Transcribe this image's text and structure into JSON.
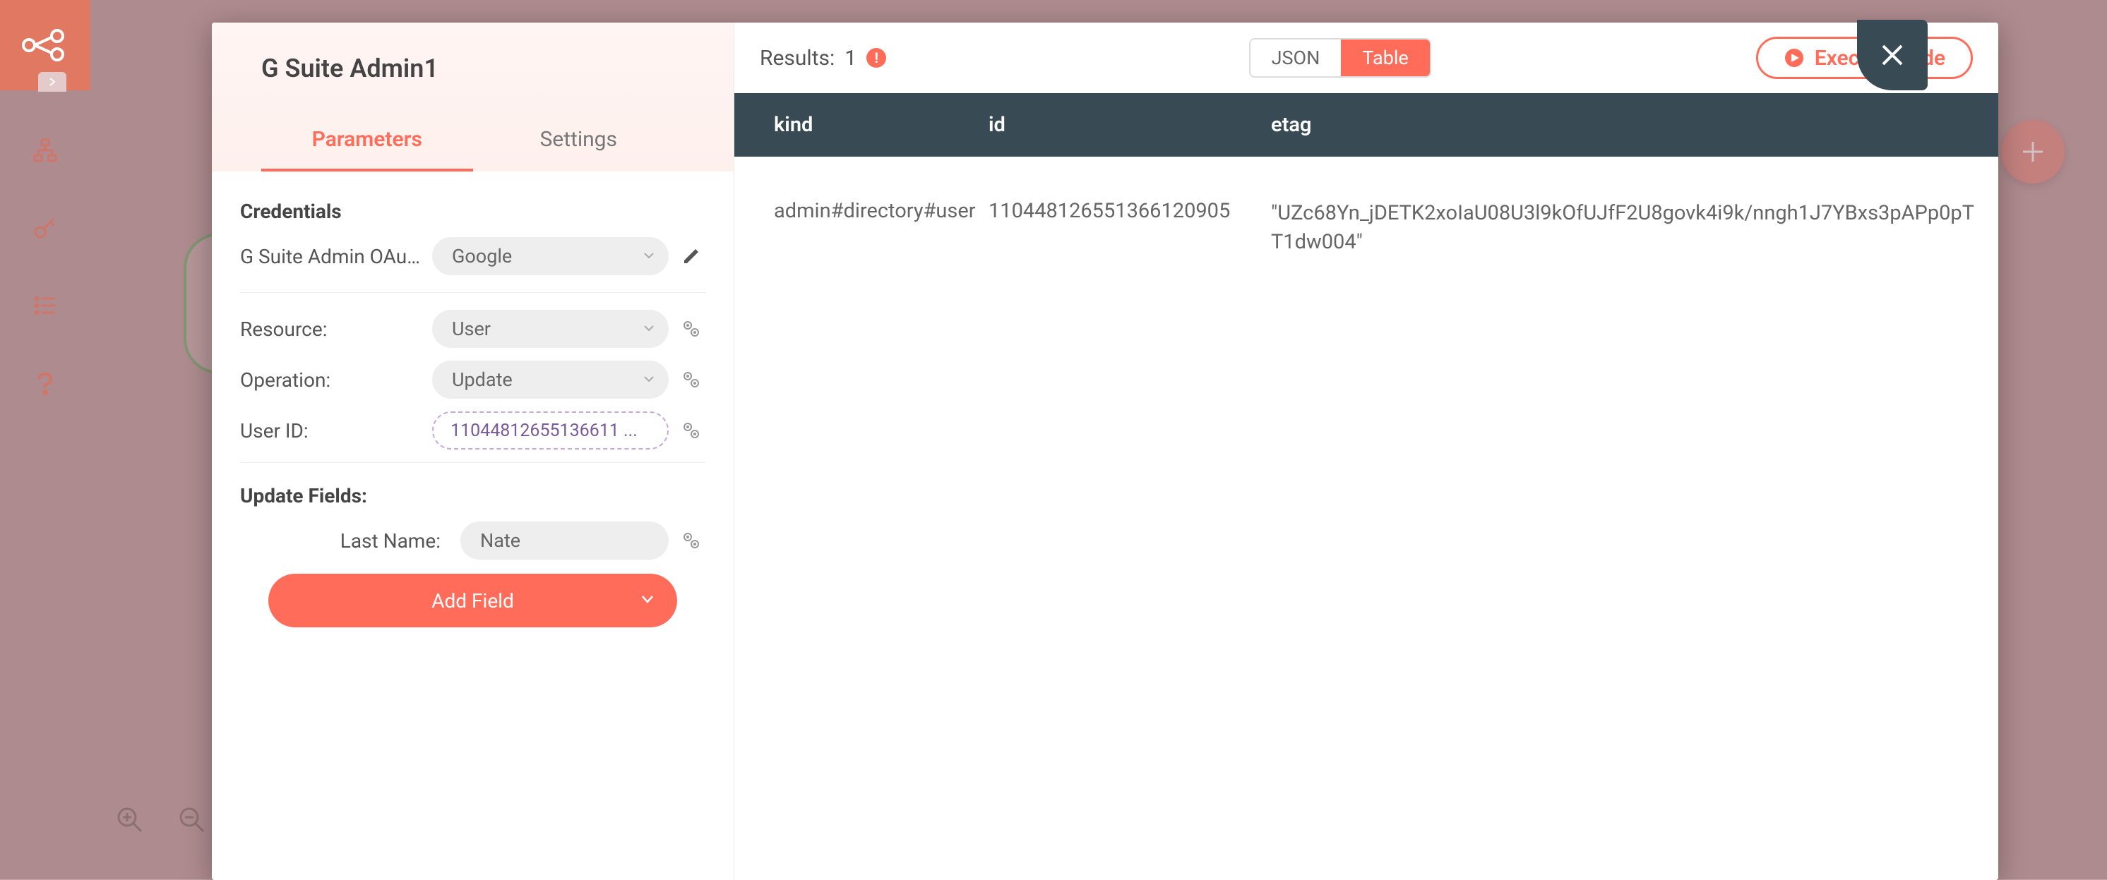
{
  "modal": {
    "title": "G Suite Admin1",
    "tabs": {
      "parameters": "Parameters",
      "settings": "Settings"
    }
  },
  "credentials": {
    "heading": "Credentials",
    "label": "G Suite Admin OAut...",
    "value": "Google"
  },
  "params": {
    "resource": {
      "label": "Resource:",
      "value": "User"
    },
    "operation": {
      "label": "Operation:",
      "value": "Update"
    },
    "userId": {
      "label": "User ID:",
      "value": "11044812655136611 ..."
    }
  },
  "updateFields": {
    "heading": "Update Fields:",
    "lastName": {
      "label": "Last Name:",
      "value": "Nate"
    },
    "addFieldLabel": "Add Field"
  },
  "results": {
    "label": "Results:",
    "count": "1",
    "headers": {
      "kind": "kind",
      "id": "id",
      "etag": "etag"
    },
    "row": {
      "kind": "admin#directory#user",
      "id": "110448126551366120905",
      "etag": "\"UZc68Yn_jDETK2xoIaU08U3l9kOfUJfF2U8govk4i9k/nngh1J7YBxs3pAPp0pTT1dw004\""
    }
  },
  "viewToggle": {
    "json": "JSON",
    "table": "Table"
  },
  "buttons": {
    "execute": "Execute Node"
  }
}
